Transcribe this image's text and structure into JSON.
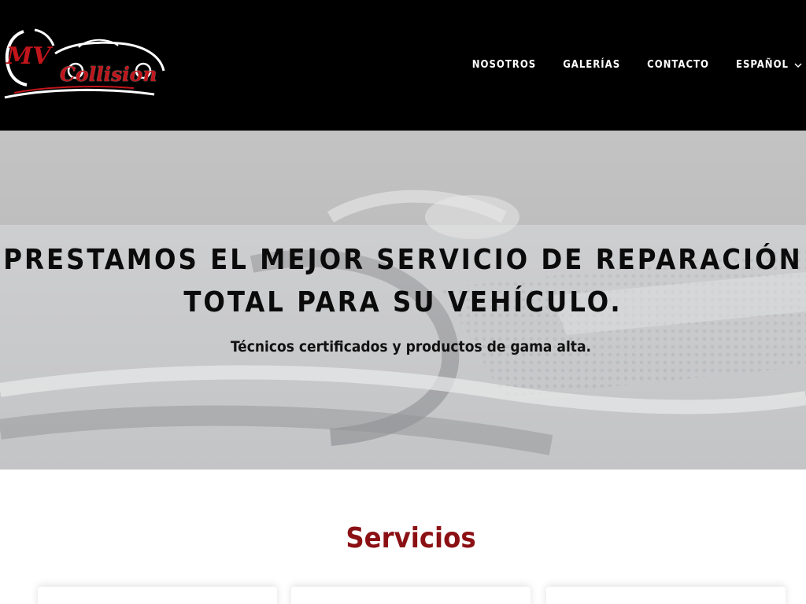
{
  "brand": {
    "logo_text_mv": "MV",
    "logo_text_collision": "Collision",
    "accent_color": "#c0151b"
  },
  "nav": {
    "items": [
      "NOSOTROS",
      "GALERÍAS",
      "CONTACTO"
    ],
    "language": "ESPAÑOL",
    "language_icon": "chevron-down-icon"
  },
  "hero": {
    "title": "PRESTAMOS EL MEJOR SERVICIO DE REPARACIÓN TOTAL PARA SU VEHÍCULO.",
    "subtitle": "Técnicos certificados y productos de gama alta."
  },
  "services": {
    "title": "Servicios",
    "title_color": "#8b1014"
  }
}
